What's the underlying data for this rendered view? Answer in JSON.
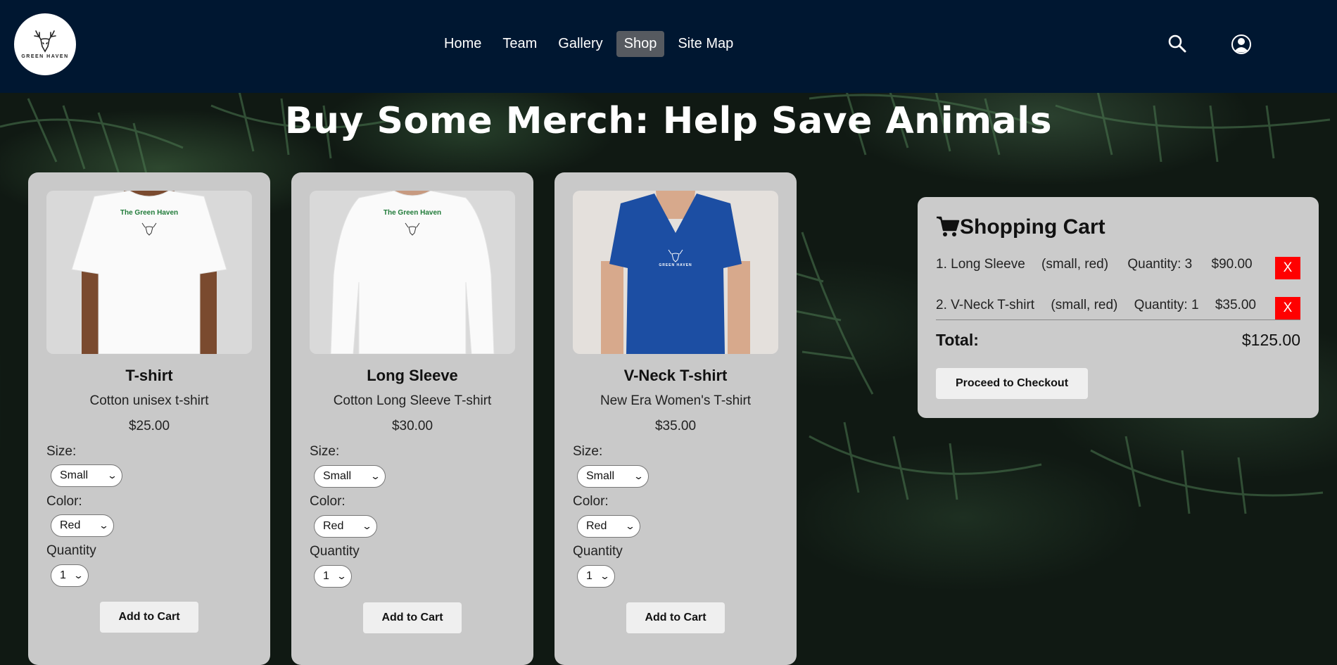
{
  "header": {
    "logo_text": "GREEN HAVEN",
    "nav": [
      {
        "label": "Home"
      },
      {
        "label": "Team"
      },
      {
        "label": "Gallery"
      },
      {
        "label": "Shop",
        "active": true
      },
      {
        "label": "Site Map"
      }
    ],
    "icons": [
      "search-icon",
      "user-icon"
    ]
  },
  "page": {
    "title": "Buy Some Merch: Help Save Animals"
  },
  "products": [
    {
      "name": "T-shirt",
      "description": "Cotton unisex t-shirt",
      "price": "$25.00",
      "shirt_text": "The Green Haven",
      "shirt_color": "#ffffff",
      "size_label": "Size:",
      "size_value": "Small",
      "color_label": "Color:",
      "color_value": "Red",
      "quantity_label": "Quantity",
      "quantity_value": "1",
      "button": "Add to Cart"
    },
    {
      "name": "Long Sleeve",
      "description": "Cotton Long Sleeve T-shirt",
      "price": "$30.00",
      "shirt_text": "The Green Haven",
      "shirt_color": "#ffffff",
      "size_label": "Size:",
      "size_value": "Small",
      "color_label": "Color:",
      "color_value": "Red",
      "quantity_label": "Quantity",
      "quantity_value": "1",
      "button": "Add to Cart"
    },
    {
      "name": "V-Neck T-shirt",
      "description": "New Era Women's T-shirt",
      "price": "$35.00",
      "shirt_text": "GREEN HAVEN",
      "shirt_color": "#1c4ea3",
      "size_label": "Size:",
      "size_value": "Small",
      "color_label": "Color:",
      "color_value": "Red",
      "quantity_label": "Quantity",
      "quantity_value": "1",
      "button": "Add to Cart"
    }
  ],
  "cart": {
    "title": "Shopping Cart",
    "items": [
      {
        "name": "1. Long Sleeve",
        "options": "(small, red)",
        "quantity": "Quantity: 3",
        "price": "$90.00",
        "remove": "X"
      },
      {
        "name": "2. V-Neck T-shirt",
        "options": "(small, red)",
        "quantity": "Quantity: 1",
        "price": "$35.00",
        "remove": "X"
      }
    ],
    "total_label": "Total:",
    "total_value": "$125.00",
    "checkout": "Proceed to Checkout"
  },
  "colors": {
    "navbar": "#001731",
    "card": "#c9c9c9",
    "remove": "#ff0000",
    "active_nav": "#565a60"
  }
}
